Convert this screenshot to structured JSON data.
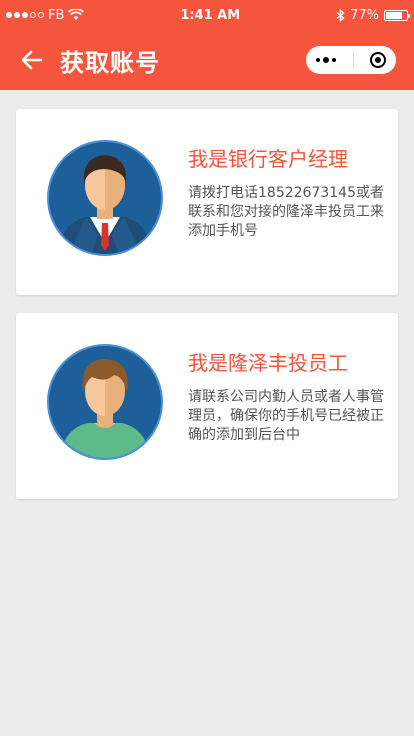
{
  "status_bar": {
    "carrier": "FB",
    "time": "1:41 AM",
    "battery_percent": "77%"
  },
  "nav": {
    "title": "获取账号"
  },
  "cards": [
    {
      "title": "我是银行客户经理",
      "description": "请拨打电话18522673145或者联系和您对接的隆泽丰投员工来添加手机号"
    },
    {
      "title": "我是隆泽丰投员工",
      "description": "请联系公司内勤人员或者人事管理员，确保你的手机号已经被正确的添加到后台中"
    }
  ],
  "colors": {
    "accent": "#f5543d",
    "background": "#ececec"
  }
}
